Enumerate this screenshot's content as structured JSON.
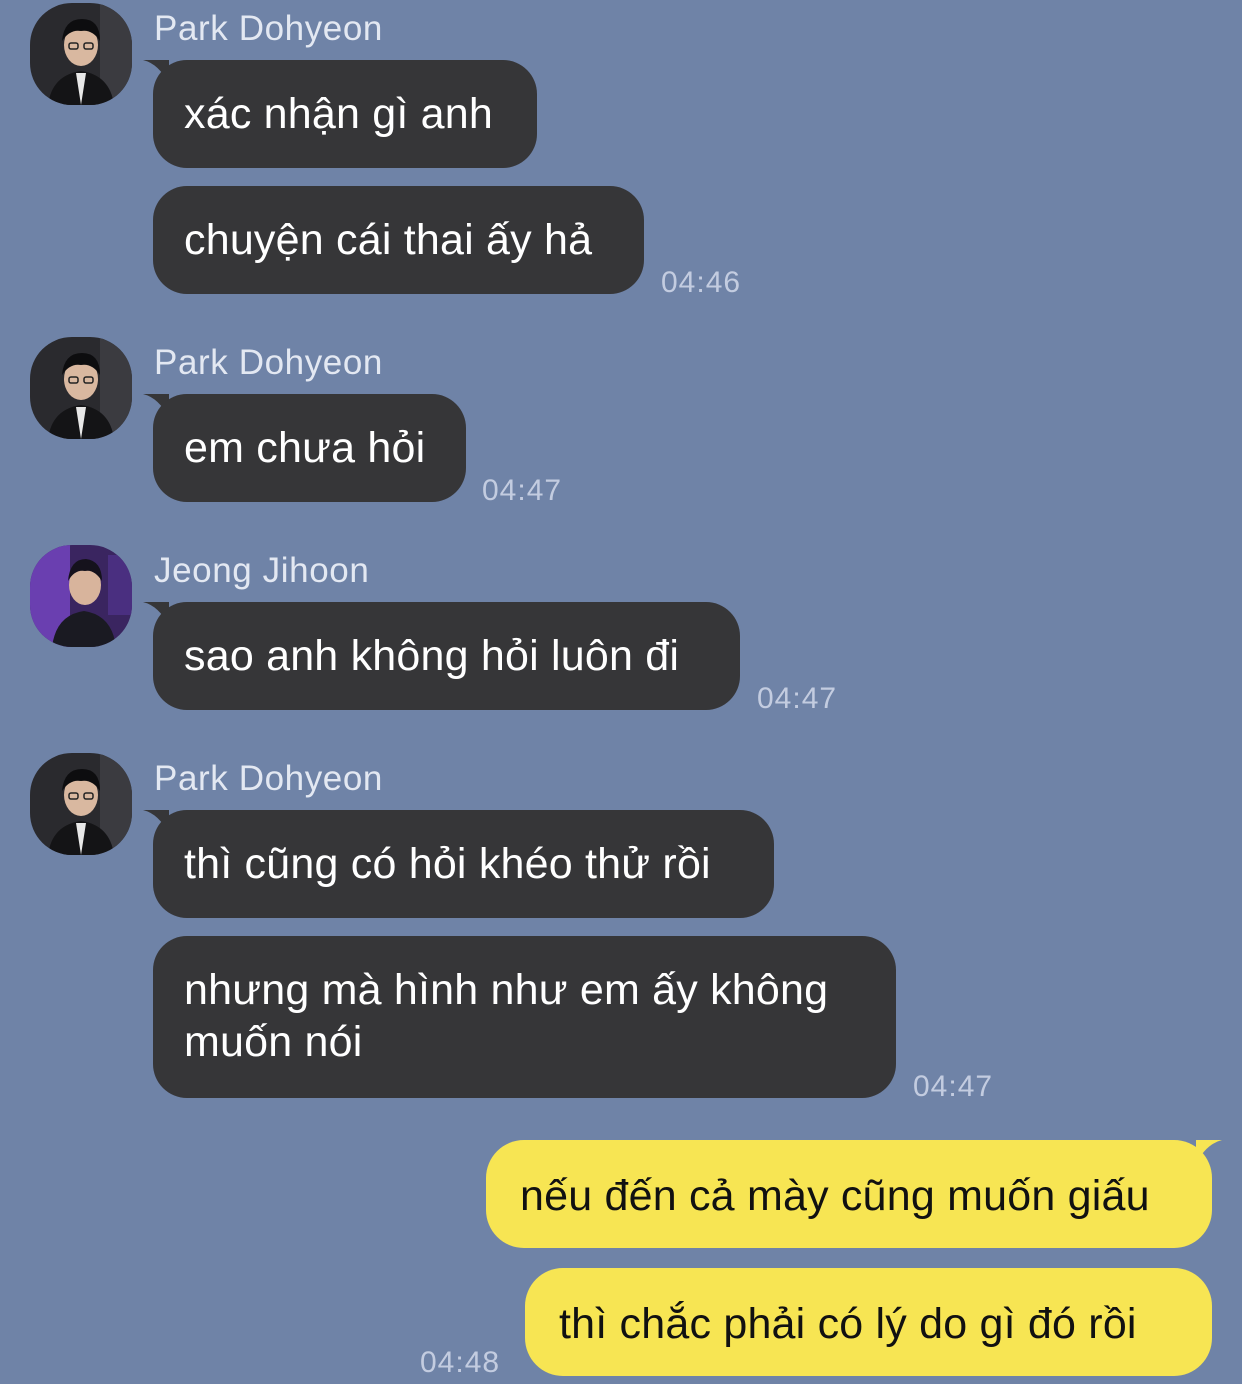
{
  "colors": {
    "background": "#6f83a7",
    "incoming_bubble": "#363638",
    "outgoing_bubble": "#f7e553",
    "name_text": "#e3e8f2",
    "timestamp_text": "#c3cce0"
  },
  "groups": [
    {
      "sender": "Park Dohyeon",
      "avatar_icon": "profile-photo-park-dohyeon",
      "messages": [
        "xác nhận gì anh",
        "chuyện cái thai ấy hả"
      ],
      "time": "04:46"
    },
    {
      "sender": "Park Dohyeon",
      "avatar_icon": "profile-photo-park-dohyeon",
      "messages": [
        "em chưa hỏi"
      ],
      "time": "04:47"
    },
    {
      "sender": "Jeong Jihoon",
      "avatar_icon": "profile-photo-jeong-jihoon",
      "messages": [
        "sao anh không hỏi luôn đi"
      ],
      "time": "04:47"
    },
    {
      "sender": "Park Dohyeon",
      "avatar_icon": "profile-photo-park-dohyeon",
      "messages": [
        "thì cũng có hỏi khéo thử rồi",
        "nhưng mà hình như em ấy không muốn nói"
      ],
      "time": "04:47"
    }
  ],
  "outgoing": {
    "messages": [
      "nếu đến cả mày cũng muốn giấu",
      "thì chắc phải có lý do gì đó rồi"
    ],
    "time": "04:48"
  }
}
